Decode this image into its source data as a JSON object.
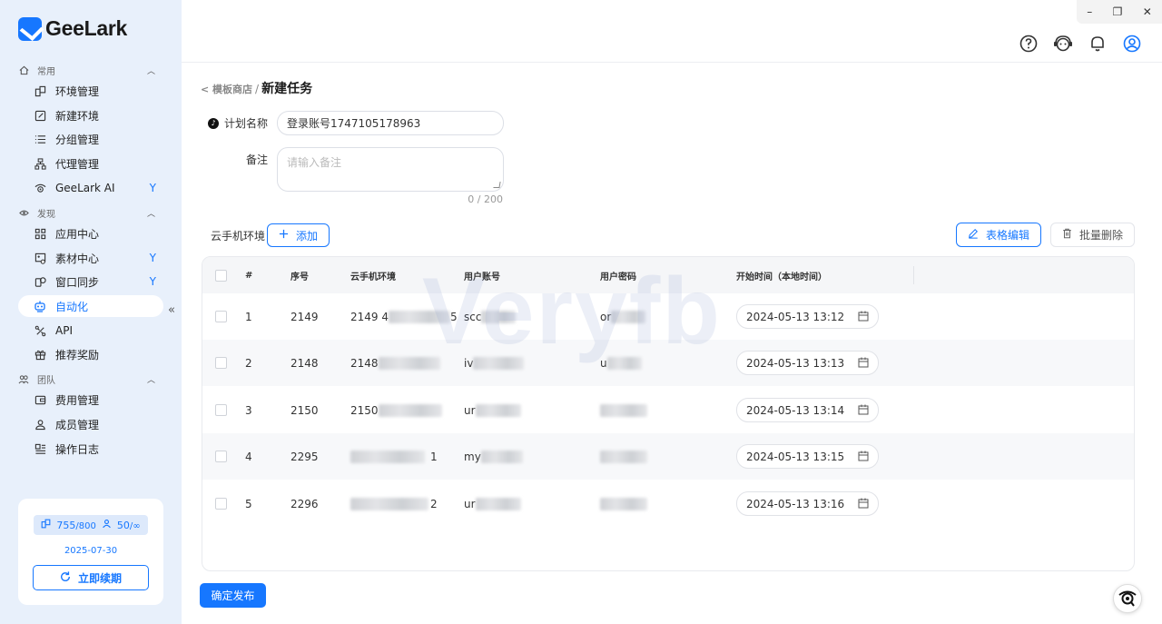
{
  "app": {
    "name": "GeeLark",
    "brand_color": "#1677ff"
  },
  "window": {
    "minimize": "–",
    "restore": "❐",
    "close": "✕"
  },
  "sidebar": {
    "sections": [
      {
        "label": "常用",
        "icon": "home-icon"
      },
      {
        "label": "发现",
        "icon": "eye-icon"
      },
      {
        "label": "团队",
        "icon": "team-icon"
      }
    ],
    "items": [
      {
        "label": "环境管理",
        "icon": "environment-icon"
      },
      {
        "label": "新建环境",
        "icon": "edit-icon"
      },
      {
        "label": "分组管理",
        "icon": "list-icon"
      },
      {
        "label": "代理管理",
        "icon": "proxy-icon"
      },
      {
        "label": "GeeLark AI",
        "icon": "ai-icon"
      },
      {
        "label": "应用中心",
        "icon": "apps-icon"
      },
      {
        "label": "素材中心",
        "icon": "materials-icon"
      },
      {
        "label": "窗口同步",
        "icon": "sync-icon"
      },
      {
        "label": "自动化",
        "icon": "robot-icon"
      },
      {
        "label": "API",
        "icon": "api-icon"
      },
      {
        "label": "推荐奖励",
        "icon": "gift-icon"
      },
      {
        "label": "费用管理",
        "icon": "wallet-icon"
      },
      {
        "label": "成员管理",
        "icon": "user-icon"
      },
      {
        "label": "操作日志",
        "icon": "log-icon"
      }
    ],
    "collapse": "«",
    "account": {
      "devices_used": "755",
      "devices_total": "/800",
      "members_used": "50",
      "members_total": "/∞",
      "expire_date": "2025-07-30",
      "renew_label": "立即续期"
    }
  },
  "header": {
    "breadcrumb_back": "< 模板商店",
    "breadcrumb_sep": "/",
    "title": "新建任务",
    "icons": [
      "help-icon",
      "customer-service-icon",
      "bell-icon",
      "profile-icon"
    ]
  },
  "form": {
    "plan_name_label": "计划名称",
    "plan_name_value": "登录账号1747105178963",
    "note_label": "备注",
    "note_placeholder": "请输入备注",
    "note_counter": "0 / 200"
  },
  "env": {
    "label": "云手机环境",
    "add_label": "添加",
    "edit_table_label": "表格编辑",
    "batch_delete_label": "批量删除"
  },
  "table": {
    "columns": [
      "#",
      "序号",
      "云手机环境",
      "用户账号",
      "用户密码",
      "开始时间（本地时间）"
    ],
    "rows": [
      {
        "idx": "1",
        "seq": "2149",
        "env_prefix": "2149 4",
        "env_suffix": "5",
        "account_prefix": "scc",
        "password_prefix": "or",
        "start": "2024-05-13 13:12"
      },
      {
        "idx": "2",
        "seq": "2148",
        "env_prefix": "2148",
        "env_suffix": "",
        "account_prefix": "iv",
        "password_prefix": "u",
        "start": "2024-05-13 13:13"
      },
      {
        "idx": "3",
        "seq": "2150",
        "env_prefix": "2150",
        "env_suffix": "",
        "account_prefix": "ur",
        "password_prefix": "",
        "start": "2024-05-13 13:14"
      },
      {
        "idx": "4",
        "seq": "2295",
        "env_prefix": "",
        "env_suffix": "1",
        "account_prefix": "my",
        "password_prefix": "",
        "start": "2024-05-13 13:15"
      },
      {
        "idx": "5",
        "seq": "2296",
        "env_prefix": "",
        "env_suffix": "2",
        "account_prefix": "ur",
        "password_prefix": "",
        "start": "2024-05-13 13:16"
      }
    ]
  },
  "footer": {
    "publish_label": "确定发布"
  },
  "watermark": "Veryfb"
}
